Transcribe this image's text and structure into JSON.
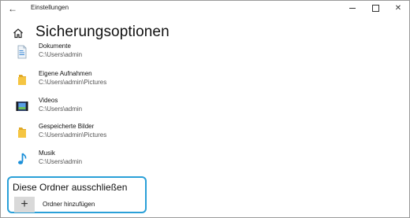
{
  "window": {
    "title": "Einstellungen",
    "back_glyph": "←",
    "close_glyph": "✕"
  },
  "header": {
    "title": "Sicherungsoptionen",
    "icon": "home-icon"
  },
  "folders": [
    {
      "name": "Dokumente",
      "path": "C:\\Users\\admin",
      "icon": "documents-icon"
    },
    {
      "name": "Eigene Aufnahmen",
      "path": "C:\\Users\\admin\\Pictures",
      "icon": "folder-icon"
    },
    {
      "name": "Videos",
      "path": "C:\\Users\\admin",
      "icon": "videos-icon"
    },
    {
      "name": "Gespeicherte Bilder",
      "path": "C:\\Users\\admin\\Pictures",
      "icon": "folder-icon"
    },
    {
      "name": "Musik",
      "path": "C:\\Users\\admin",
      "icon": "music-icon"
    }
  ],
  "exclude": {
    "heading": "Diese Ordner ausschließen",
    "add_label": "Ordner hinzufügen",
    "add_glyph": "+"
  },
  "colors": {
    "highlight_border": "#2aa0d8",
    "folder_yellow": "#f5c542",
    "music_blue": "#1a8fd8"
  }
}
